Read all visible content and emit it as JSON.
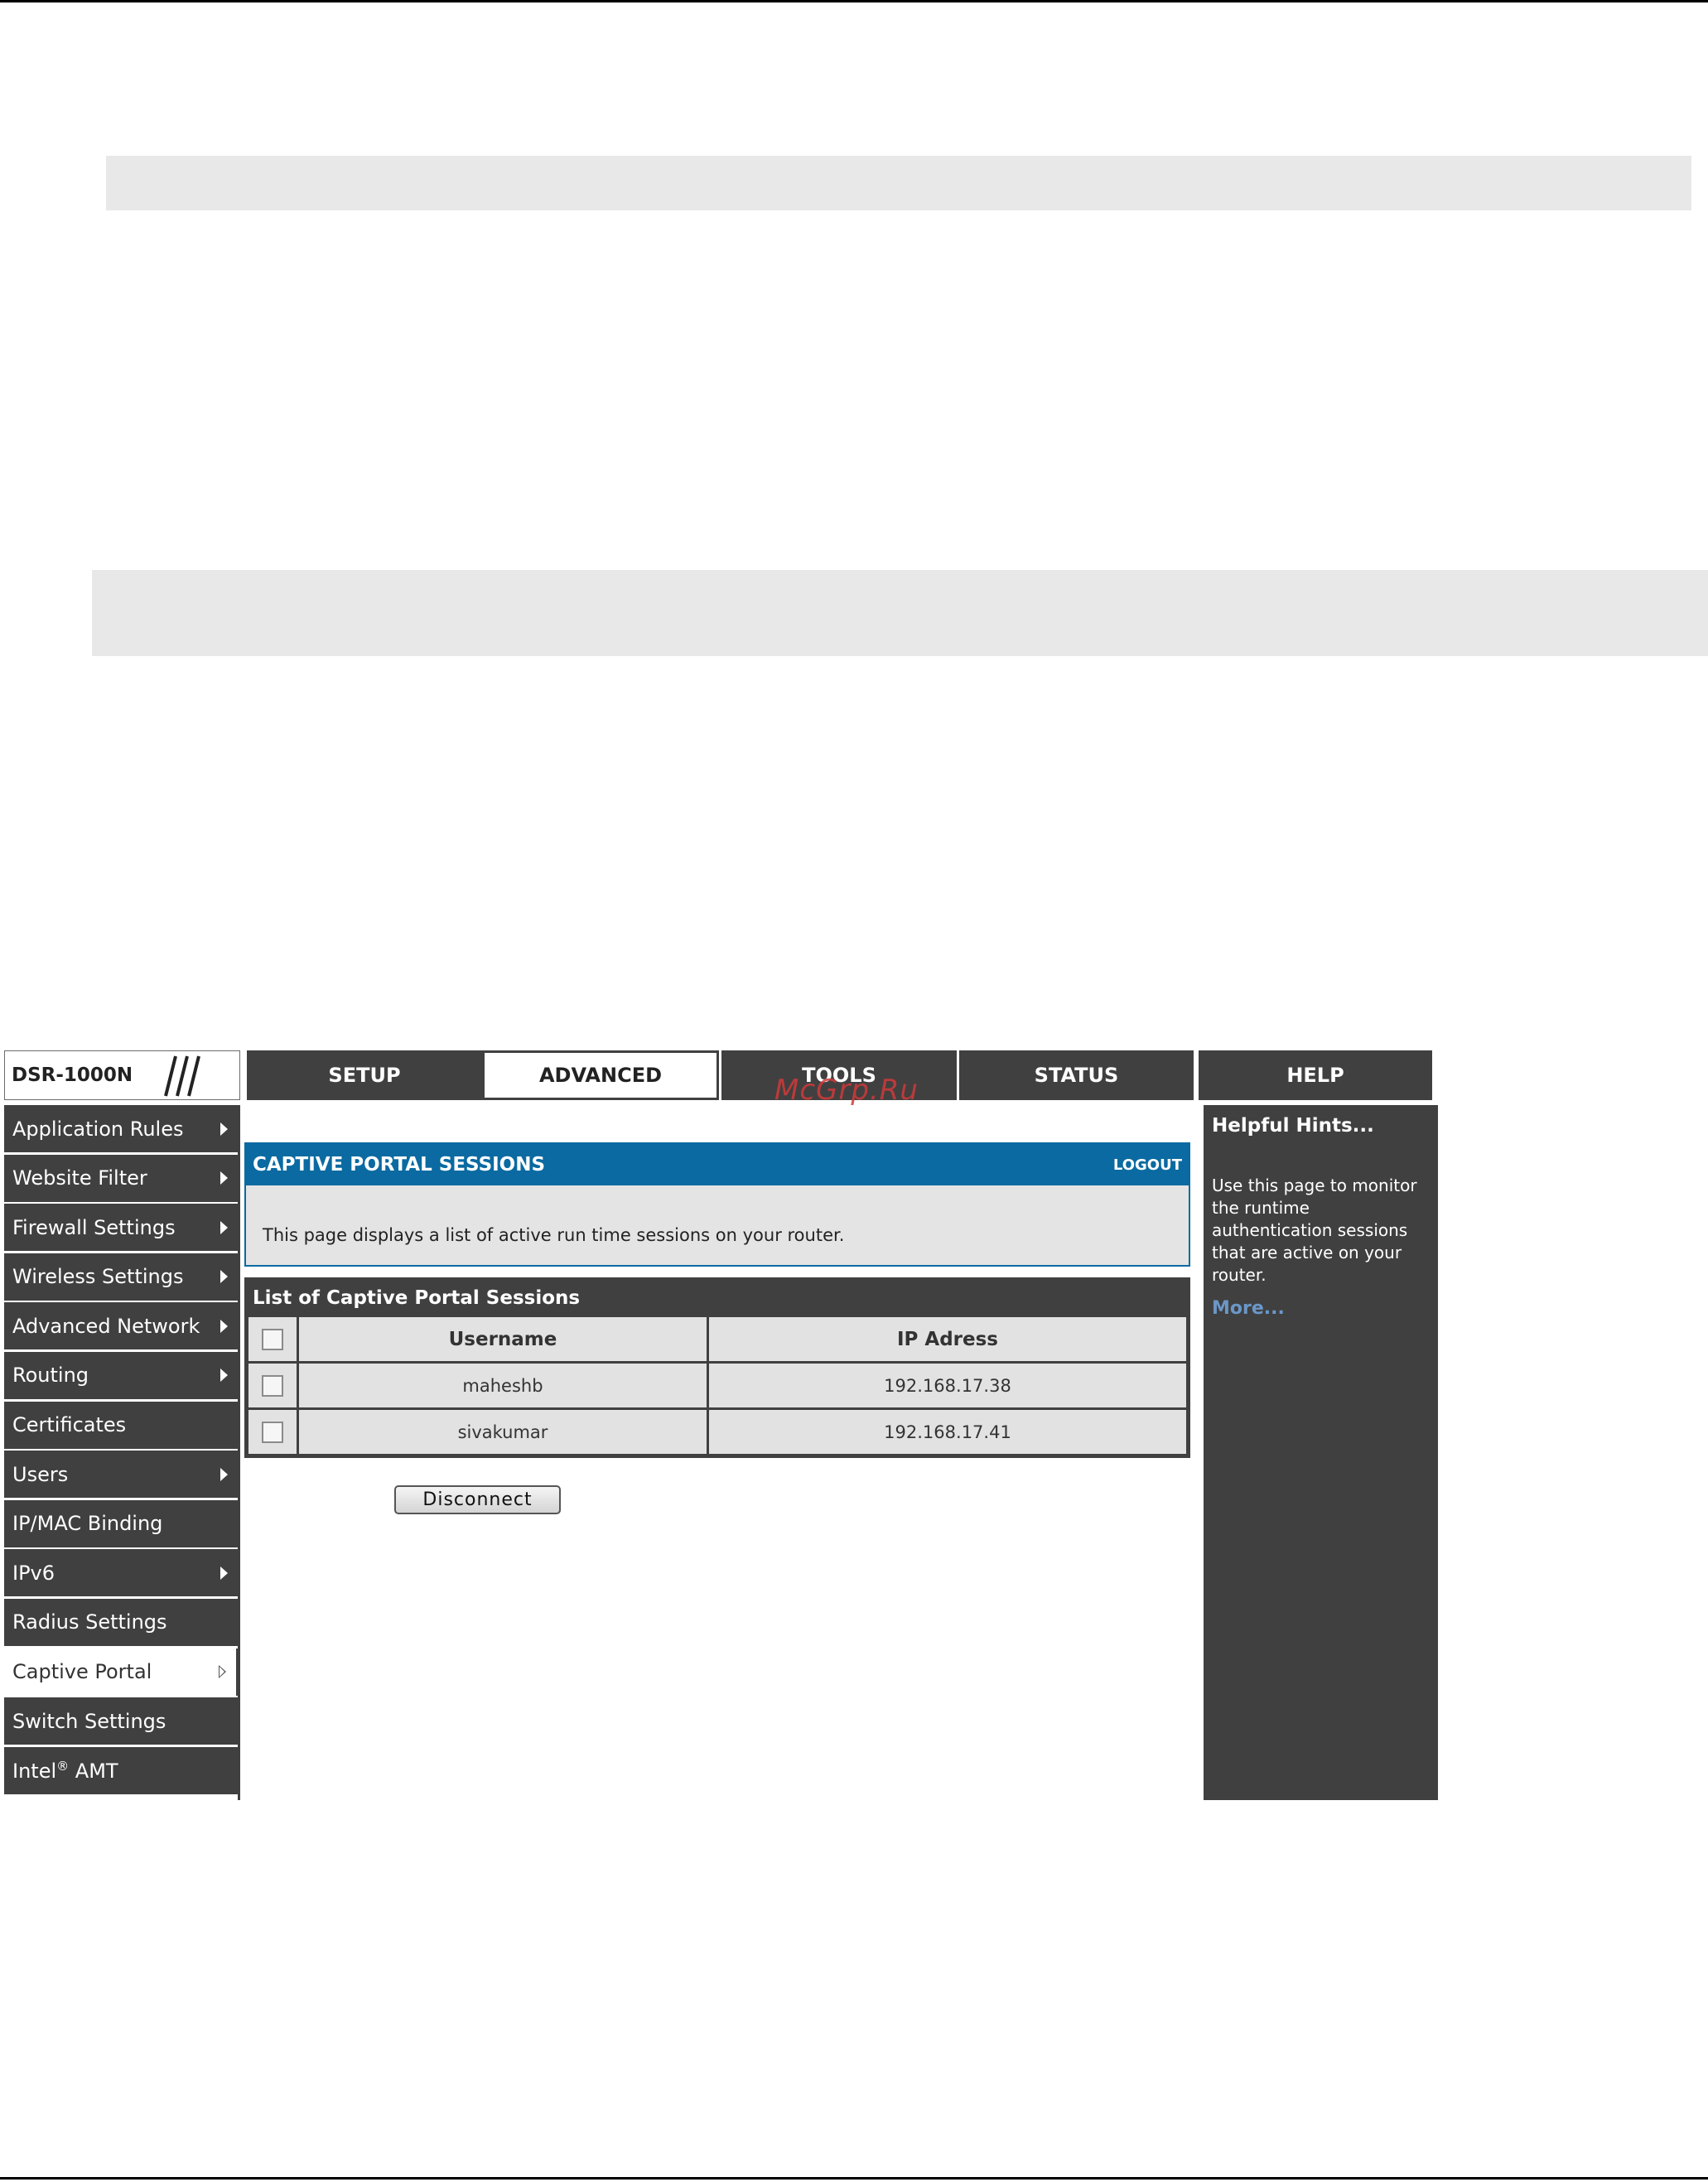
{
  "logo": {
    "model": "DSR-1000N"
  },
  "watermark": "McGrp.Ru",
  "top_nav": [
    {
      "label": "SETUP",
      "active": false
    },
    {
      "label": "ADVANCED",
      "active": true
    },
    {
      "label": "TOOLS",
      "active": false
    },
    {
      "label": "STATUS",
      "active": false
    },
    {
      "label": "HELP",
      "active": false
    }
  ],
  "sidebar": {
    "items": [
      {
        "label": "Application Rules",
        "arrow": true
      },
      {
        "label": "Website Filter",
        "arrow": true
      },
      {
        "label": "Firewall Settings",
        "arrow": true
      },
      {
        "label": "Wireless Settings",
        "arrow": true
      },
      {
        "label": "Advanced Network",
        "arrow": true
      },
      {
        "label": "Routing",
        "arrow": true
      },
      {
        "label": "Certificates",
        "arrow": false
      },
      {
        "label": "Users",
        "arrow": true
      },
      {
        "label": "IP/MAC Binding",
        "arrow": false
      },
      {
        "label": "IPv6",
        "arrow": true
      },
      {
        "label": "Radius Settings",
        "arrow": false
      },
      {
        "label": "Captive Portal",
        "arrow": true,
        "active": true
      },
      {
        "label": "Switch Settings",
        "arrow": false
      },
      {
        "label": "Intel",
        "sup": "®",
        "suffix": " AMT",
        "arrow": false
      }
    ]
  },
  "main": {
    "header_title": "CAPTIVE PORTAL SESSIONS",
    "logout_label": "LOGOUT",
    "description": "This page displays a list of active run time sessions on your router.",
    "list_title": "List of Captive Portal Sessions",
    "columns": [
      "Username",
      "IP Adress"
    ],
    "rows": [
      {
        "username": "maheshb",
        "ip": "192.168.17.38"
      },
      {
        "username": "sivakumar",
        "ip": "192.168.17.41"
      }
    ],
    "disconnect_label": "Disconnect"
  },
  "help": {
    "title": "Helpful Hints...",
    "text": "Use this page to monitor the runtime authentication sessions that are active on your router.",
    "more_label": "More..."
  },
  "colors": {
    "nav_dark": "#404040",
    "header_blue": "#0a6aa1",
    "link_blue": "#6b97c8"
  }
}
